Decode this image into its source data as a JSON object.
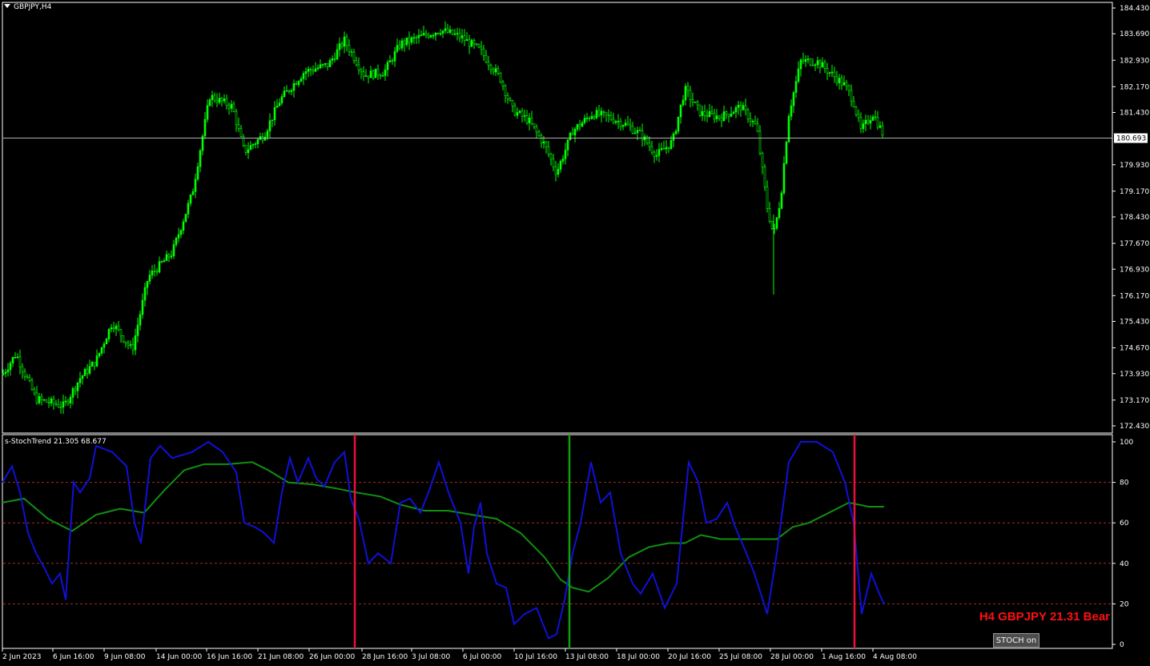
{
  "chart": {
    "symbol_title": "GBPJPY,H4",
    "current_price": "180.693",
    "price_axis_labels": [
      "184.430",
      "183.690",
      "182.930",
      "182.170",
      "181.430",
      "180.693",
      "179.930",
      "179.170",
      "178.430",
      "177.670",
      "176.930",
      "176.170",
      "175.430",
      "174.670",
      "173.930",
      "173.170",
      "172.430"
    ],
    "time_axis_labels": [
      "2 Jun 2023",
      "6 Jun 16:00",
      "9 Jun 08:00",
      "14 Jun 00:00",
      "16 Jun 16:00",
      "21 Jun 08:00",
      "26 Jun 00:00",
      "28 Jun 16:00",
      "3 Jul 08:00",
      "6 Jul 00:00",
      "10 Jul 16:00",
      "13 Jul 08:00",
      "18 Jul 00:00",
      "20 Jul 16:00",
      "25 Jul 08:00",
      "28 Jul 00:00",
      "1 Aug 16:00",
      "4 Aug 08:00"
    ],
    "colors": {
      "background": "#000000",
      "candles": "#00ff00",
      "grid_line": "#c8c8c8",
      "frame": "#ffffff"
    }
  },
  "indicator": {
    "title": "s-StochTrend 21.305 68.677",
    "scale_labels": [
      "100",
      "80",
      "60",
      "40",
      "20",
      "0"
    ],
    "levels": [
      80,
      60,
      40,
      20
    ],
    "colors": {
      "main": "#1010d8",
      "signal": "#109010",
      "level": "#a03020",
      "bear_marker": "#e8103c",
      "bull_marker": "#10a010"
    },
    "markers": [
      {
        "type": "bear",
        "time": "28 Jun 12:00"
      },
      {
        "type": "bull",
        "time": "12 Jul 20:00"
      },
      {
        "type": "bear",
        "time": "1 Aug 16:00"
      }
    ]
  },
  "signal_label": "H4 GBPJPY 21.31 Bear",
  "stoch_button": "STOCH on"
}
